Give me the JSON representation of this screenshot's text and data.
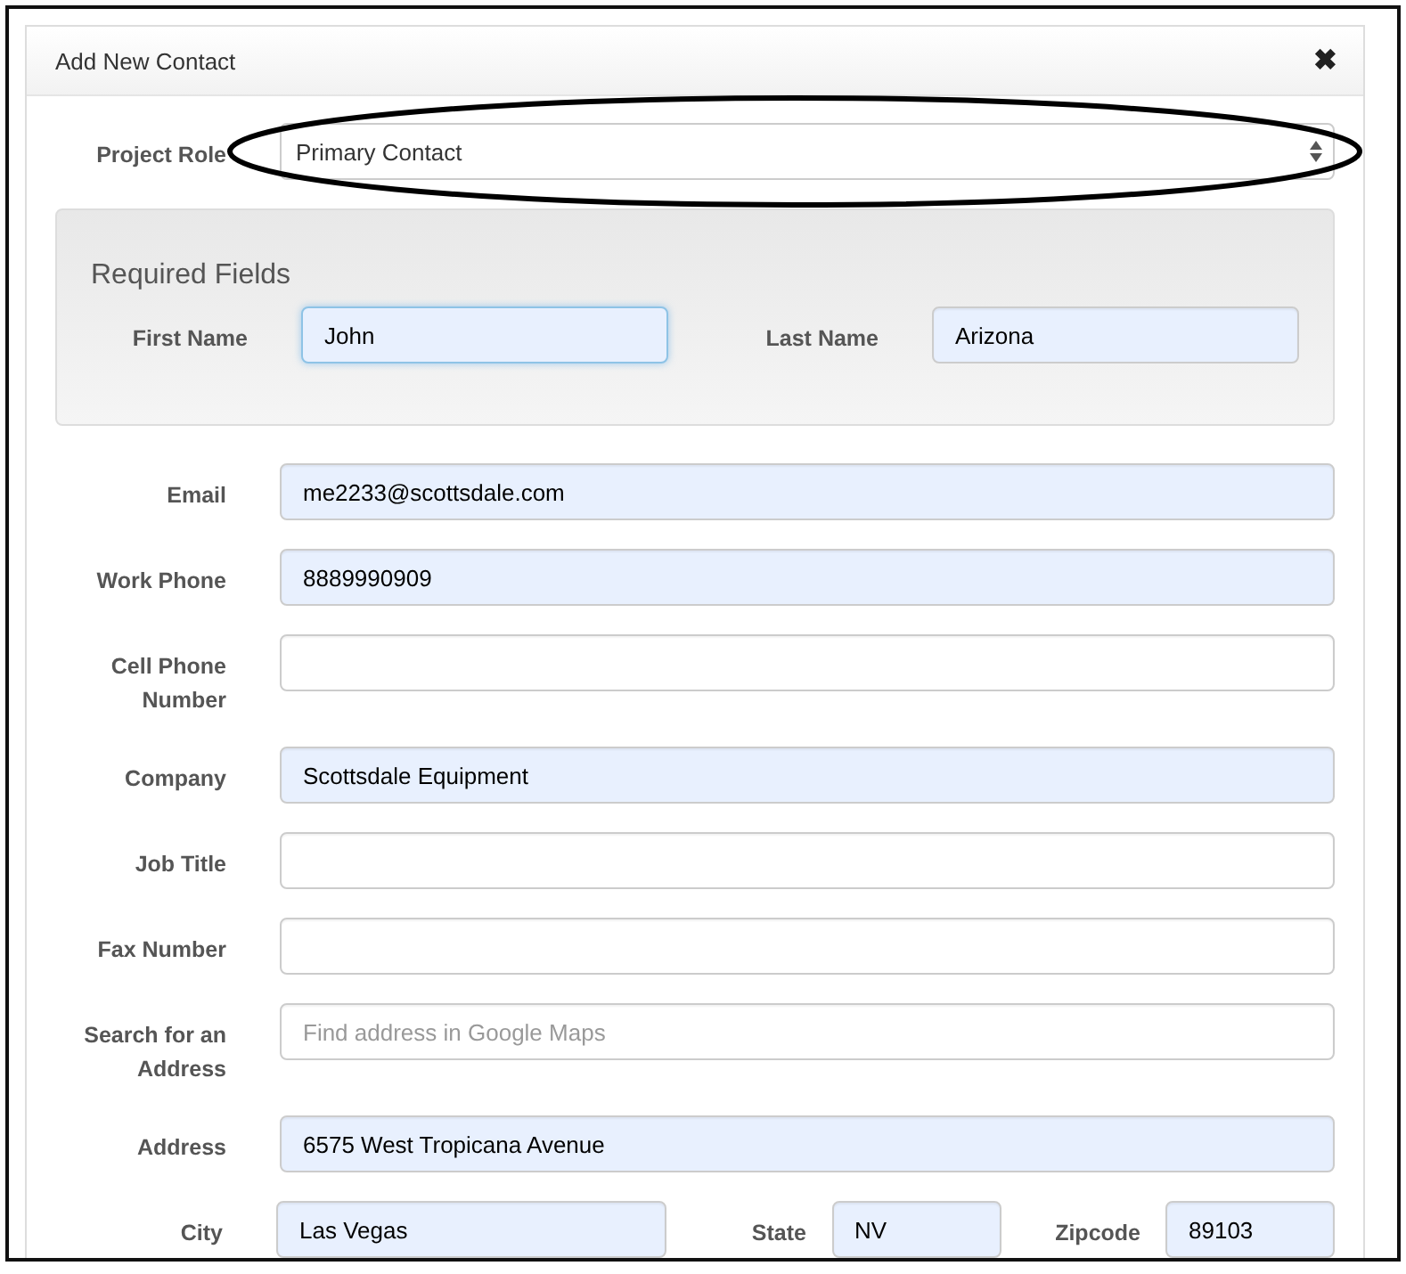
{
  "dialog": {
    "title": "Add New Contact",
    "close_icon": "✖"
  },
  "project_role": {
    "label": "Project Role",
    "value": "Primary Contact",
    "highlighted": true
  },
  "required_fields": {
    "heading": "Required Fields",
    "fields": [
      {
        "label": "First Name",
        "value": "John",
        "autofilled": true,
        "focused": true
      },
      {
        "label": "Last Name",
        "value": "Arizona",
        "autofilled": true,
        "focused": false
      }
    ]
  },
  "fields": [
    {
      "label": "Email",
      "value": "me2233@scottsdale.com",
      "autofilled": true
    },
    {
      "label": "Work Phone",
      "value": "8889990909",
      "autofilled": true
    },
    {
      "label": "Cell Phone Number",
      "autofilled": false
    },
    {
      "label": "Company",
      "value": "Scottsdale Equipment",
      "autofilled": true
    },
    {
      "label": "Job Title",
      "autofilled": false
    },
    {
      "label": "Fax Number",
      "autofilled": false
    },
    {
      "label": "Search for an Address",
      "placeholder": "Find address in Google Maps",
      "autofilled": false
    },
    {
      "label": "Address",
      "value": "6575 West Tropicana Avenue",
      "autofilled": true
    }
  ],
  "location_row": [
    {
      "label": "City",
      "value": "Las Vegas",
      "autofilled": true
    },
    {
      "label": "State",
      "value": "NV",
      "autofilled": true
    },
    {
      "label": "Zipcode",
      "value": "89103",
      "autofilled": true
    }
  ]
}
